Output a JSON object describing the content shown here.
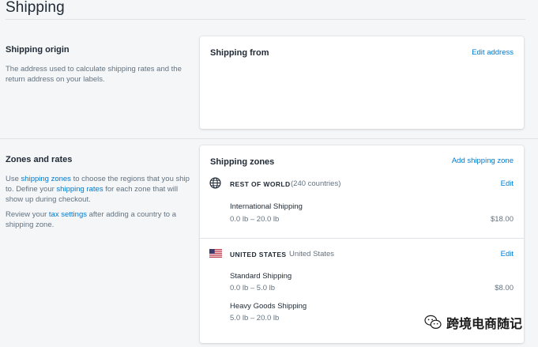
{
  "page": {
    "title": "Shipping"
  },
  "origin": {
    "heading": "Shipping origin",
    "desc": "The address used to calculate shipping rates and the return address on your labels.",
    "card_title": "Shipping from",
    "edit_label": "Edit address"
  },
  "zones": {
    "heading": "Zones and rates",
    "p1_a": "Use ",
    "p1_link1": "shipping zones",
    "p1_b": " to choose the regions that you ship to. Define your ",
    "p1_link2": "shipping rates",
    "p1_c": " for each zone that will show up during checkout.",
    "p2_a": "Review your ",
    "p2_link": "tax settings",
    "p2_b": " after adding a country to a shipping zone.",
    "card_title": "Shipping zones",
    "add_label": "Add shipping zone",
    "list": [
      {
        "name": "REST OF WORLD",
        "sub": "(240 countries)",
        "edit": "Edit",
        "icon": "globe-icon",
        "rates": [
          {
            "name": "International Shipping",
            "range": "0.0 lb – 20.0 lb",
            "price": "$18.00"
          }
        ]
      },
      {
        "name": "UNITED STATES",
        "sub": "United States",
        "edit": "Edit",
        "icon": "us-flag-icon",
        "rates": [
          {
            "name": "Standard Shipping",
            "range": "0.0 lb – 5.0 lb",
            "price": "$8.00"
          },
          {
            "name": "Heavy Goods Shipping",
            "range": "5.0 lb – 20.0 lb",
            "price": ""
          }
        ]
      }
    ]
  },
  "watermark": {
    "text": "跨境电商随记",
    "icon": "wechat-icon"
  },
  "colors": {
    "link": "#007ace",
    "background": "#f4f6f8",
    "text": "#212b36",
    "muted": "#637381"
  }
}
